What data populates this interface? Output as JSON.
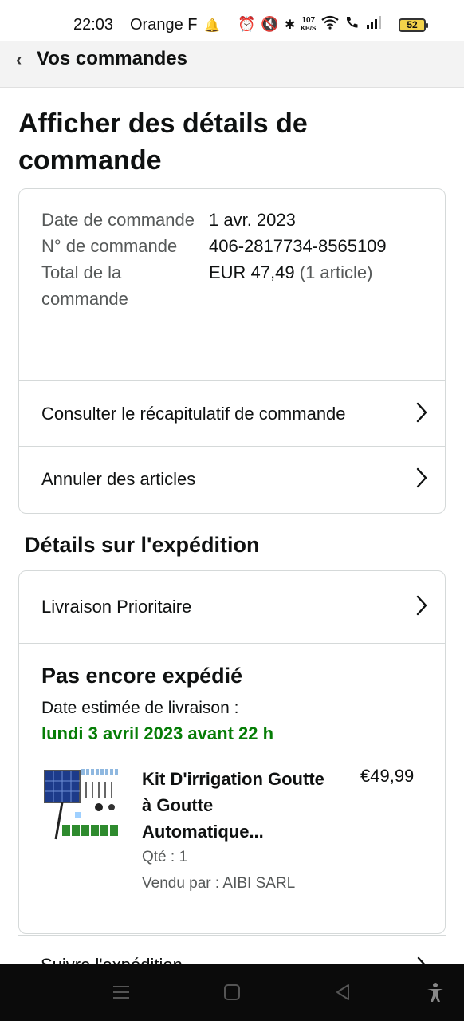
{
  "status_bar": {
    "time": "22:03",
    "carrier": "Orange F",
    "speed_top": "107",
    "speed_bottom": "KB/S",
    "battery": "52"
  },
  "nav": {
    "back_label": "Vos commandes"
  },
  "page_title": "Afficher des détails de commande",
  "order_info": {
    "rows": [
      {
        "label": "Date de commande",
        "value": "1 avr. 2023"
      },
      {
        "label": "N° de commande",
        "value": "406-2817734-8565109"
      },
      {
        "label": "Total de la commande",
        "value": "EUR 47,49",
        "value_extra": "(1 article)"
      }
    ]
  },
  "links": {
    "summary": "Consulter le récapitulatif de commande",
    "cancel": "Annuler des articles"
  },
  "shipping": {
    "section_title": "Détails sur l'expédition",
    "method": "Livraison Prioritaire",
    "status": "Pas encore expédié",
    "estimate_label": "Date estimée de livraison :",
    "estimate_date": "lundi 3 avril 2023 avant 22 h",
    "track_label": "Suivre l'expédition"
  },
  "product": {
    "title": "Kit D'irrigation Goutte à Goutte Automatique...",
    "price": "€49,99",
    "qty": "Qté : 1",
    "seller": "Vendu par : AIBI SARL"
  },
  "colors": {
    "accent_green": "#067d06",
    "border": "#d5d9d9",
    "muted_text": "#565959"
  }
}
